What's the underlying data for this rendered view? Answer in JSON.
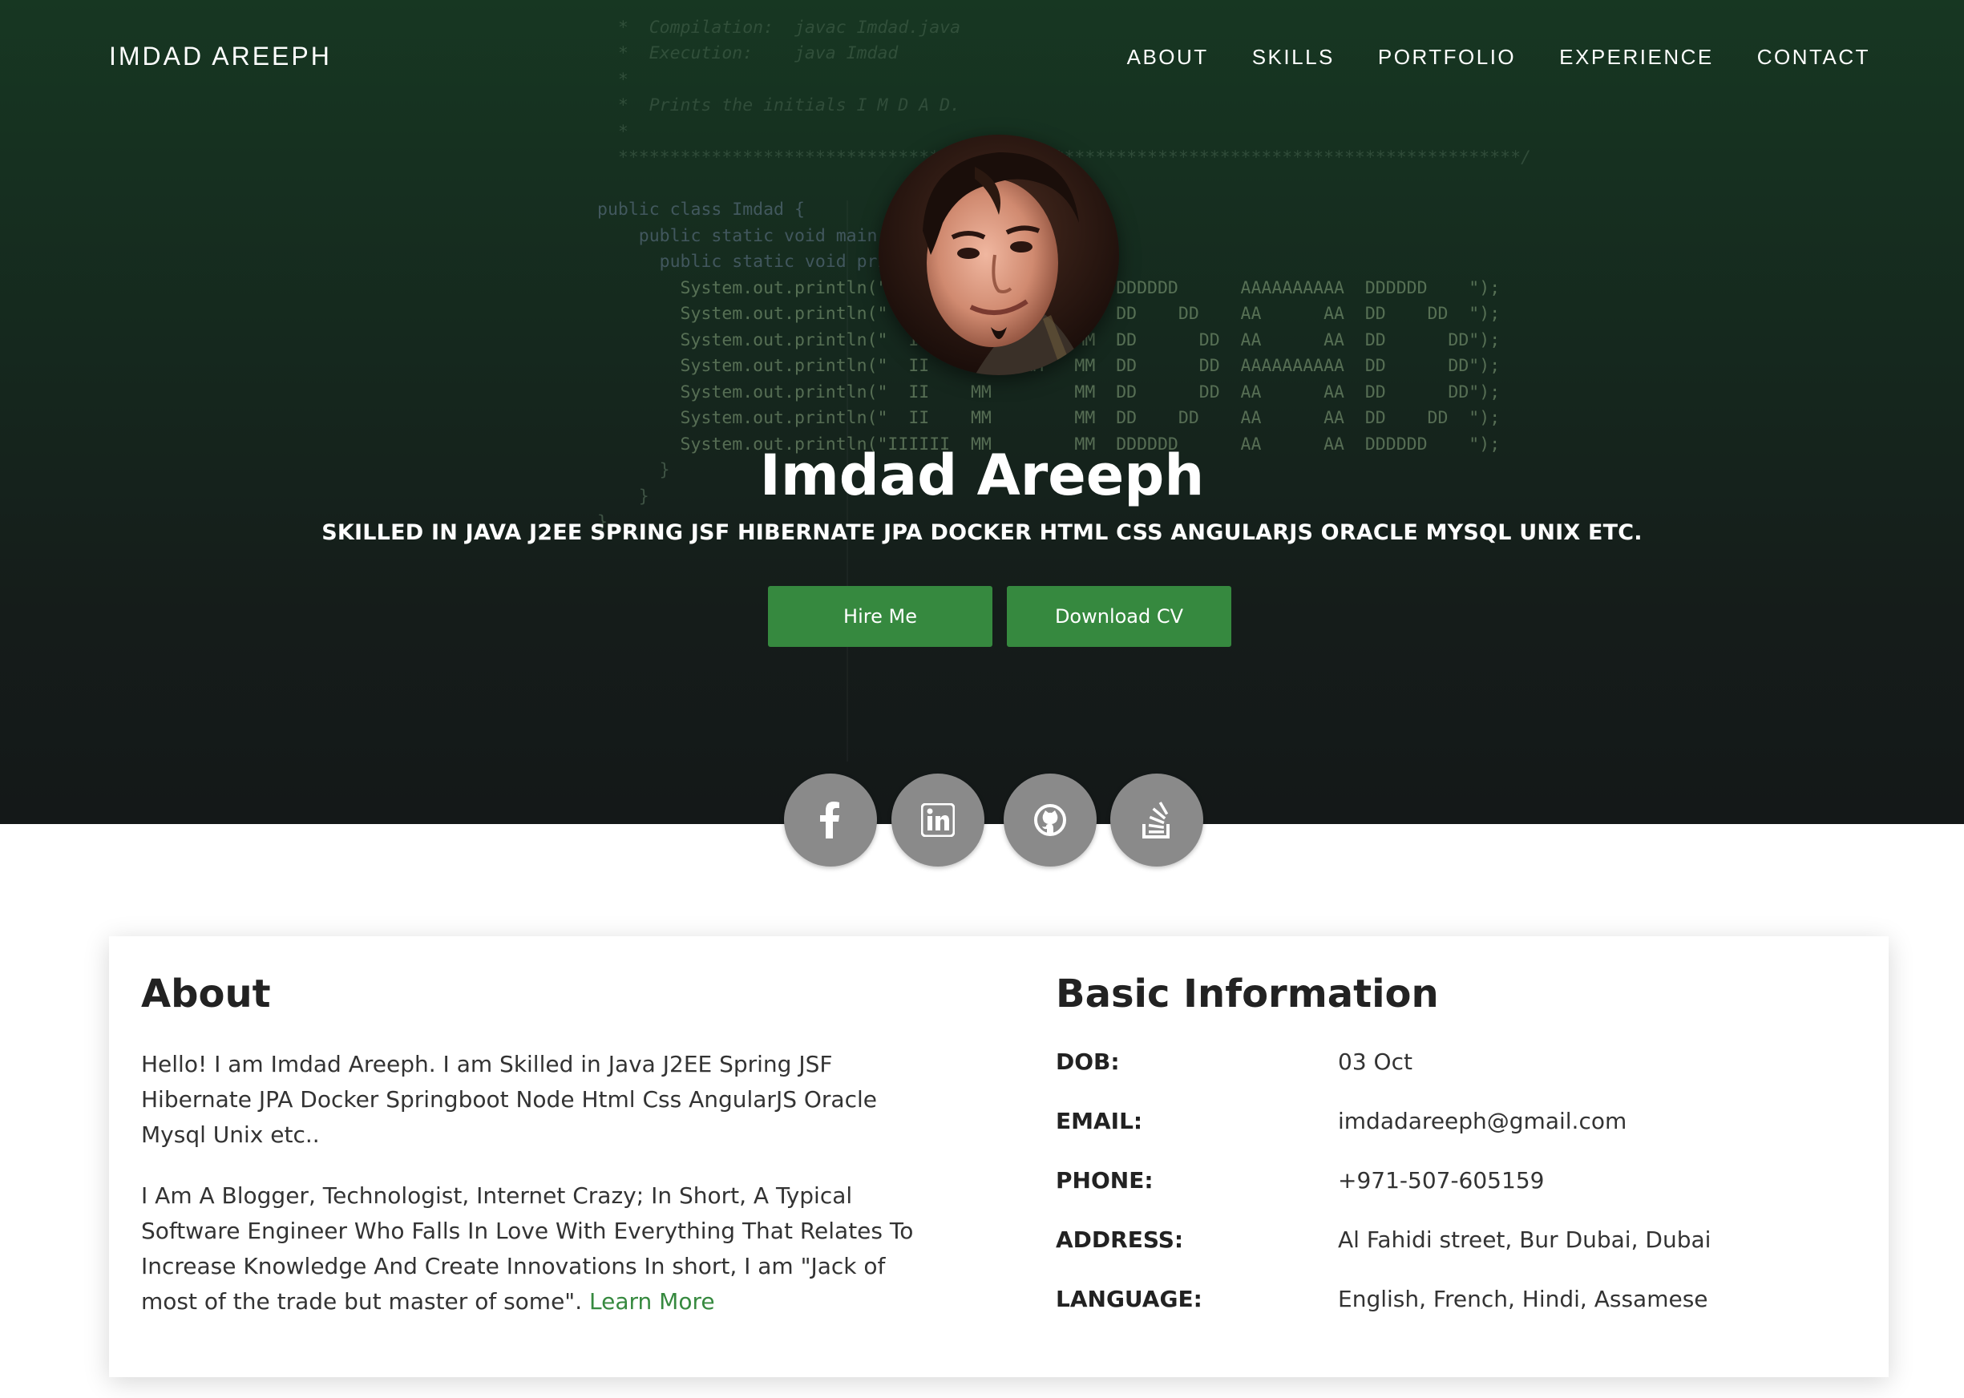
{
  "nav": {
    "brand": "IMDAD AREEPH",
    "links": [
      "ABOUT",
      "SKILLS",
      "PORTFOLIO",
      "EXPERIENCE",
      "CONTACT"
    ]
  },
  "hero": {
    "name": "Imdad Areeph",
    "skills": "SKILLED IN JAVA J2EE SPRING JSF HIBERNATE JPA DOCKER HTML CSS ANGULARJS ORACLE MYSQL UNIX ETC.",
    "hire_label": "Hire Me",
    "cv_label": "Download CV",
    "code_lines": [
      "  *  Compilation:  javac Imdad.java",
      "  *  Execution:    java Imdad",
      "  *",
      "  *  Prints the initials I M D A D.",
      "  *",
      "  ***************************************************************************************/",
      "",
      "public class Imdad {",
      "    public static void main(String[] args) {",
      "      public static void printInitials() {",
      "        System.out.println(\"IIIIII  MM        MM  DDDDDD      AAAAAAAAAA  DDDDDD    \");",
      "        System.out.println(\"  II    MMMM    MMMM  DD    DD    AA      AA  DD    DD  \");",
      "        System.out.println(\"  II    MM  MMMM  MM  DD      DD  AA      AA  DD      DD\");",
      "        System.out.println(\"  II    MM   MM   MM  DD      DD  AAAAAAAAAA  DD      DD\");",
      "        System.out.println(\"  II    MM        MM  DD      DD  AA      AA  DD      DD\");",
      "        System.out.println(\"  II    MM        MM  DD    DD    AA      AA  DD    DD  \");",
      "        System.out.println(\"IIIIII  MM        MM  DDDDDD      AA      AA  DDDDDD    \");",
      "      }",
      "    }",
      "}"
    ]
  },
  "social": [
    "facebook-icon",
    "linkedin-icon",
    "github-icon",
    "stackoverflow-icon"
  ],
  "about": {
    "title": "About",
    "p1": "Hello! I am Imdad Areeph. I am Skilled in Java J2EE Spring JSF Hibernate JPA Docker Springboot Node Html Css AngularJS Oracle Mysql Unix etc..",
    "p2": "I Am A Blogger, Technologist, Internet Crazy; In Short, A Typical Software Engineer Who Falls In Love With Everything That Relates To Increase Knowledge And Create Innovations In short, I am \"Jack of most of the trade but master of some\".",
    "learn_more": "Learn More"
  },
  "info": {
    "title": "Basic Information",
    "rows": [
      {
        "label": "DOB:",
        "value": "03 Oct"
      },
      {
        "label": "EMAIL:",
        "value": "imdadareeph@gmail.com"
      },
      {
        "label": "PHONE:",
        "value": "+971-507-605159"
      },
      {
        "label": "ADDRESS:",
        "value": "Al Fahidi street, Bur Dubai, Dubai"
      },
      {
        "label": "LANGUAGE:",
        "value": "English, French, Hindi, Assamese"
      }
    ]
  },
  "colors": {
    "accent": "#36893f",
    "hero_top": "#173722",
    "hero_bottom": "#141818",
    "social_bg": "#8a8a8a"
  }
}
